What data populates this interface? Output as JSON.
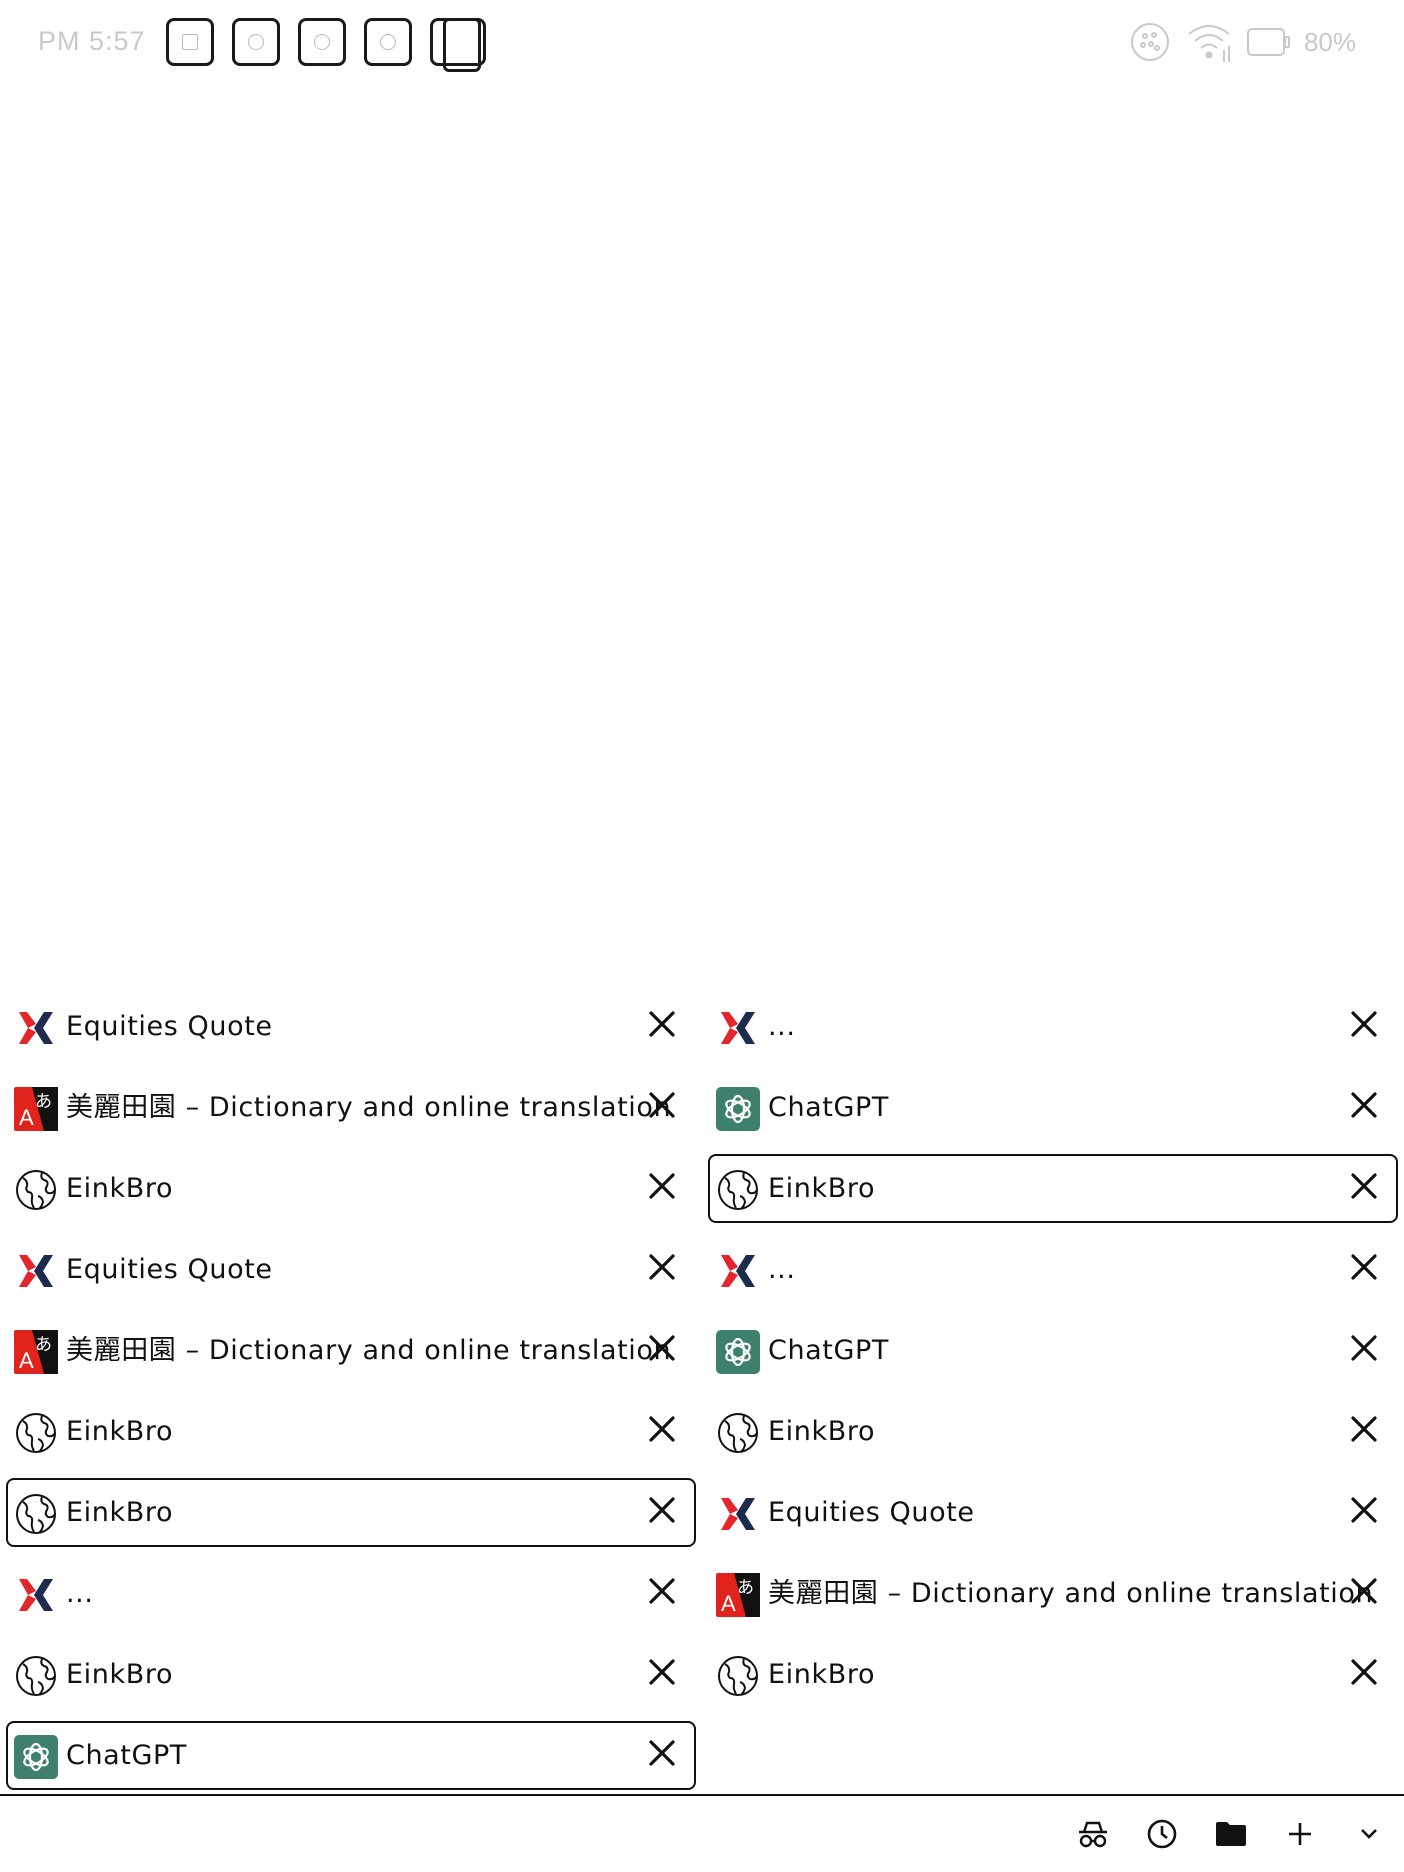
{
  "status_bar": {
    "time": "PM  5:57",
    "battery": "80%",
    "notification_icons": [
      "reader-app-icon",
      "browser-app-icon",
      "browser-app-icon",
      "browser-app-icon",
      "recent-apps-icon"
    ],
    "system_icons": [
      "settings-dots-icon",
      "wifi-icon",
      "battery-icon"
    ]
  },
  "tabs": {
    "left_column": [
      {
        "title": "Equities Quote",
        "favicon": "x-logo-icon",
        "selected": false
      },
      {
        "title": "美麗田園 – Dictionary and online translation",
        "favicon": "translate-icon",
        "selected": false
      },
      {
        "title": "EinkBro",
        "favicon": "globe-icon",
        "selected": false
      },
      {
        "title": "Equities Quote",
        "favicon": "x-logo-icon",
        "selected": false
      },
      {
        "title": "美麗田園 – Dictionary and online translation",
        "favicon": "translate-icon",
        "selected": false
      },
      {
        "title": "EinkBro",
        "favicon": "globe-icon",
        "selected": false
      },
      {
        "title": "EinkBro",
        "favicon": "globe-icon",
        "selected": true
      },
      {
        "title": "...",
        "favicon": "x-logo-icon",
        "selected": false
      },
      {
        "title": "EinkBro",
        "favicon": "globe-icon",
        "selected": false
      },
      {
        "title": "ChatGPT",
        "favicon": "chatgpt-icon",
        "selected": true
      }
    ],
    "right_column": [
      {
        "title": "...",
        "favicon": "x-logo-icon",
        "selected": false
      },
      {
        "title": "ChatGPT",
        "favicon": "chatgpt-icon",
        "selected": false
      },
      {
        "title": "EinkBro",
        "favicon": "globe-icon",
        "selected": true
      },
      {
        "title": "...",
        "favicon": "x-logo-icon",
        "selected": false
      },
      {
        "title": "ChatGPT",
        "favicon": "chatgpt-icon",
        "selected": false
      },
      {
        "title": "EinkBro",
        "favicon": "globe-icon",
        "selected": false
      },
      {
        "title": "Equities Quote",
        "favicon": "x-logo-icon",
        "selected": false
      },
      {
        "title": "美麗田園 – Dictionary and online translation",
        "favicon": "translate-icon",
        "selected": false
      },
      {
        "title": "EinkBro",
        "favicon": "globe-icon",
        "selected": false
      }
    ],
    "close_icon": "close-icon"
  },
  "toolbar": {
    "buttons": [
      "incognito-icon",
      "history-icon",
      "folder-icon",
      "add-icon",
      "chevron-down-icon"
    ]
  },
  "colors": {
    "x_logo_red": "#e3262b",
    "x_logo_navy": "#1d2b4f",
    "translate_red": "#e0231c",
    "chatgpt_green": "#3f7f6d",
    "status_gray": "#c9c9c9"
  }
}
